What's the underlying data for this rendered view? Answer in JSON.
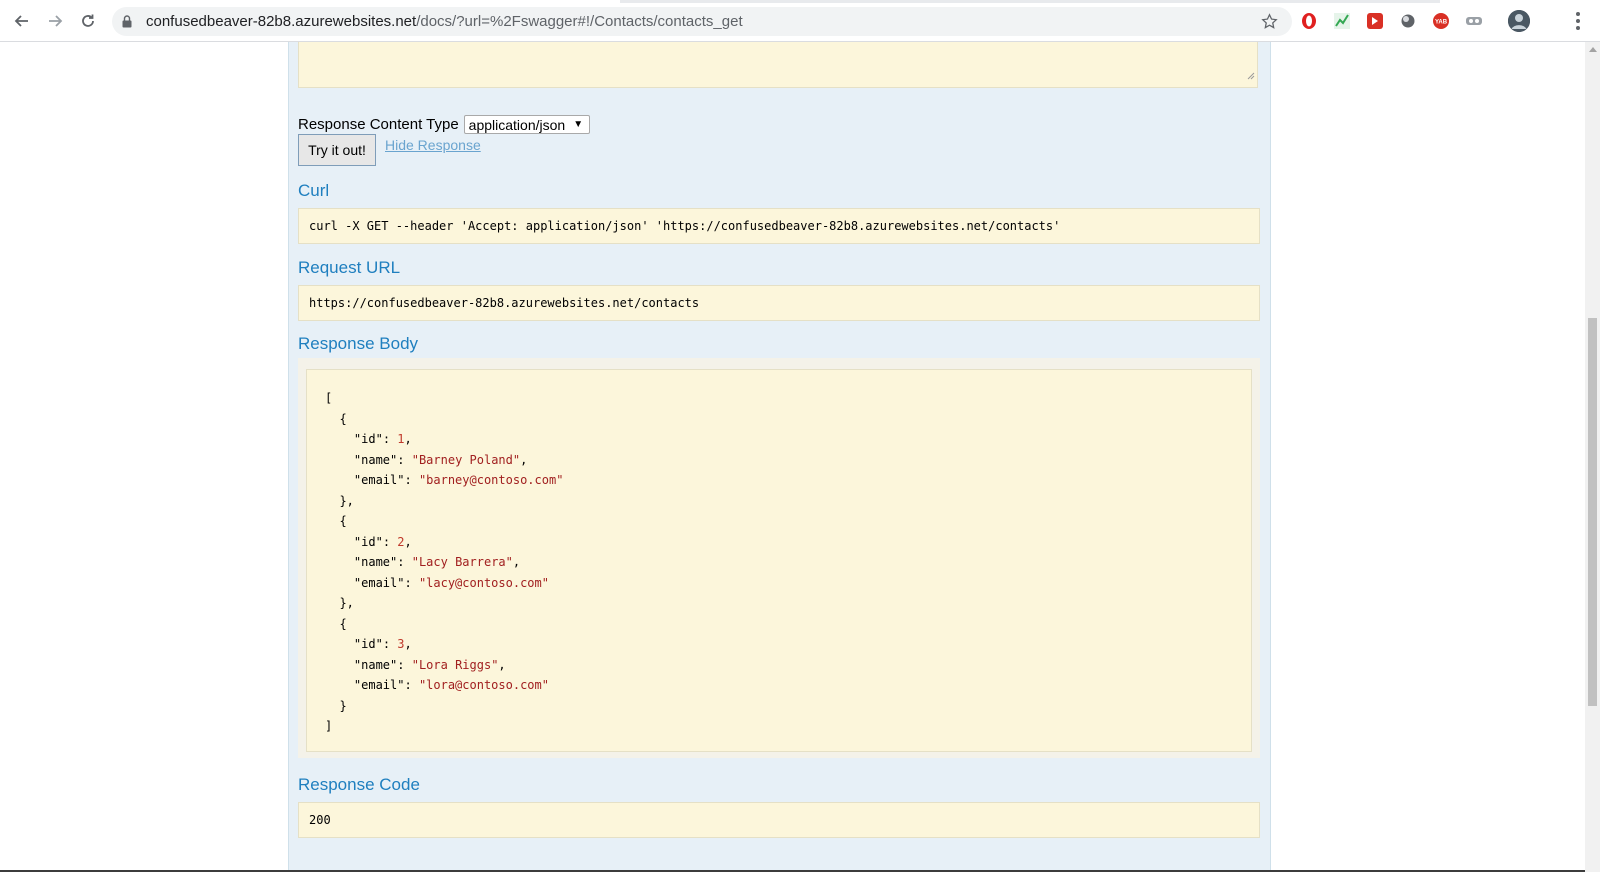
{
  "browser": {
    "url_host": "confusedbeaver-82b8.azurewebsites.net",
    "url_path": "/docs/?url=%2Fswagger#!/Contacts/contacts_get",
    "icons": [
      "back-icon",
      "forward-icon",
      "reload-icon",
      "lock-icon",
      "bookmark-star-icon",
      "menu-icon"
    ],
    "extensions": [
      {
        "name": "opera-extension-icon",
        "color": "#e02020"
      },
      {
        "name": "chart-extension-icon",
        "color": "#34a853"
      },
      {
        "name": "play-extension-icon",
        "color": "#d93025"
      },
      {
        "name": "circle-extension-icon",
        "color": "#5f6368"
      },
      {
        "name": "yab-extension-icon",
        "color": "#d93025"
      },
      {
        "name": "glasses-extension-icon",
        "color": "#9aa0a6"
      }
    ]
  },
  "operation": {
    "response_content_type_label": "Response Content Type",
    "content_type_selected": "application/json",
    "try_button": "Try it out!",
    "hide_response_link": "Hide Response",
    "curl_heading": "Curl",
    "curl_command": "curl -X GET --header 'Accept: application/json' 'https://confusedbeaver-82b8.azurewebsites.net/contacts'",
    "request_url_heading": "Request URL",
    "request_url": "https://confusedbeaver-82b8.azurewebsites.net/contacts",
    "response_body_heading": "Response Body",
    "response_body_lines": [
      {
        "indent": "",
        "key": "",
        "val": "",
        "type": "punct",
        "tail": "["
      },
      {
        "indent": "  ",
        "key": "",
        "val": "",
        "type": "punct",
        "tail": "{"
      },
      {
        "indent": "    ",
        "key": "\"id\"",
        "val": "1",
        "type": "num",
        "tail": ","
      },
      {
        "indent": "    ",
        "key": "\"name\"",
        "val": "\"Barney Poland\"",
        "type": "str",
        "tail": ","
      },
      {
        "indent": "    ",
        "key": "\"email\"",
        "val": "\"barney@contoso.com\"",
        "type": "str",
        "tail": ""
      },
      {
        "indent": "  ",
        "key": "",
        "val": "",
        "type": "punct",
        "tail": "},"
      },
      {
        "indent": "  ",
        "key": "",
        "val": "",
        "type": "punct",
        "tail": "{"
      },
      {
        "indent": "    ",
        "key": "\"id\"",
        "val": "2",
        "type": "num",
        "tail": ","
      },
      {
        "indent": "    ",
        "key": "\"name\"",
        "val": "\"Lacy Barrera\"",
        "type": "str",
        "tail": ","
      },
      {
        "indent": "    ",
        "key": "\"email\"",
        "val": "\"lacy@contoso.com\"",
        "type": "str",
        "tail": ""
      },
      {
        "indent": "  ",
        "key": "",
        "val": "",
        "type": "punct",
        "tail": "},"
      },
      {
        "indent": "  ",
        "key": "",
        "val": "",
        "type": "punct",
        "tail": "{"
      },
      {
        "indent": "    ",
        "key": "\"id\"",
        "val": "3",
        "type": "num",
        "tail": ","
      },
      {
        "indent": "    ",
        "key": "\"name\"",
        "val": "\"Lora Riggs\"",
        "type": "str",
        "tail": ","
      },
      {
        "indent": "    ",
        "key": "\"email\"",
        "val": "\"lora@contoso.com\"",
        "type": "str",
        "tail": ""
      },
      {
        "indent": "  ",
        "key": "",
        "val": "",
        "type": "punct",
        "tail": "}"
      },
      {
        "indent": "",
        "key": "",
        "val": "",
        "type": "punct",
        "tail": "]"
      }
    ],
    "response_code_heading": "Response Code",
    "response_code": "200"
  }
}
